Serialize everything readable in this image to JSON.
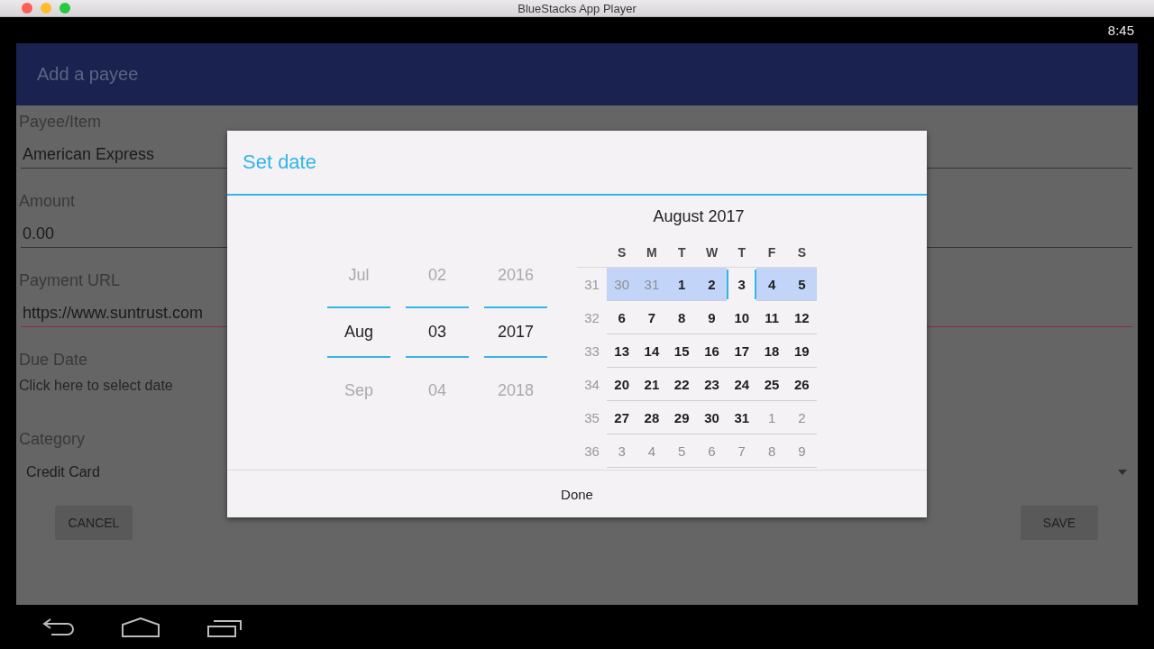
{
  "window": {
    "title": "BlueStacks App Player"
  },
  "status_bar": {
    "time": "8:45"
  },
  "app_bar": {
    "title": "Add a payee"
  },
  "form": {
    "fields": [
      {
        "kind": "text",
        "label": "Payee/Item",
        "value": "American Express",
        "error": false
      },
      {
        "kind": "text",
        "label": "Amount",
        "value": "0.00",
        "error": false
      },
      {
        "kind": "text",
        "label": "Payment URL",
        "value": "https://www.suntrust.com",
        "error": true
      },
      {
        "kind": "date",
        "label": "Due Date",
        "placeholder": "Click here to select date"
      },
      {
        "kind": "select",
        "label": "Category",
        "value": "Credit Card"
      }
    ],
    "buttons": [
      "CANCEL",
      "SAVE"
    ]
  },
  "dialog": {
    "title": "Set date",
    "spinners": [
      {
        "previous": "Jul",
        "current": "Aug",
        "next": "Sep"
      },
      {
        "previous": "02",
        "current": "03",
        "next": "04"
      },
      {
        "previous": "2016",
        "current": "2017",
        "next": "2018"
      }
    ],
    "calendar": {
      "title": "August 2017",
      "weekdays": [
        "S",
        "M",
        "T",
        "W",
        "T",
        "F",
        "S"
      ],
      "weeks": [
        {
          "number": "31",
          "highlighted": true,
          "days": [
            {
              "label": "30",
              "in_month": false,
              "selected": false
            },
            {
              "label": "31",
              "in_month": false,
              "selected": false
            },
            {
              "label": "1",
              "in_month": true,
              "selected": false
            },
            {
              "label": "2",
              "in_month": true,
              "selected": false
            },
            {
              "label": "3",
              "in_month": true,
              "selected": true
            },
            {
              "label": "4",
              "in_month": true,
              "selected": false
            },
            {
              "label": "5",
              "in_month": true,
              "selected": false
            }
          ]
        },
        {
          "number": "32",
          "highlighted": false,
          "days": [
            {
              "label": "6",
              "in_month": true,
              "selected": false
            },
            {
              "label": "7",
              "in_month": true,
              "selected": false
            },
            {
              "label": "8",
              "in_month": true,
              "selected": false
            },
            {
              "label": "9",
              "in_month": true,
              "selected": false
            },
            {
              "label": "10",
              "in_month": true,
              "selected": false
            },
            {
              "label": "11",
              "in_month": true,
              "selected": false
            },
            {
              "label": "12",
              "in_month": true,
              "selected": false
            }
          ]
        },
        {
          "number": "33",
          "highlighted": false,
          "days": [
            {
              "label": "13",
              "in_month": true,
              "selected": false
            },
            {
              "label": "14",
              "in_month": true,
              "selected": false
            },
            {
              "label": "15",
              "in_month": true,
              "selected": false
            },
            {
              "label": "16",
              "in_month": true,
              "selected": false
            },
            {
              "label": "17",
              "in_month": true,
              "selected": false
            },
            {
              "label": "18",
              "in_month": true,
              "selected": false
            },
            {
              "label": "19",
              "in_month": true,
              "selected": false
            }
          ]
        },
        {
          "number": "34",
          "highlighted": false,
          "days": [
            {
              "label": "20",
              "in_month": true,
              "selected": false
            },
            {
              "label": "21",
              "in_month": true,
              "selected": false
            },
            {
              "label": "22",
              "in_month": true,
              "selected": false
            },
            {
              "label": "23",
              "in_month": true,
              "selected": false
            },
            {
              "label": "24",
              "in_month": true,
              "selected": false
            },
            {
              "label": "25",
              "in_month": true,
              "selected": false
            },
            {
              "label": "26",
              "in_month": true,
              "selected": false
            }
          ]
        },
        {
          "number": "35",
          "highlighted": false,
          "days": [
            {
              "label": "27",
              "in_month": true,
              "selected": false
            },
            {
              "label": "28",
              "in_month": true,
              "selected": false
            },
            {
              "label": "29",
              "in_month": true,
              "selected": false
            },
            {
              "label": "30",
              "in_month": true,
              "selected": false
            },
            {
              "label": "31",
              "in_month": true,
              "selected": false
            },
            {
              "label": "1",
              "in_month": false,
              "selected": false
            },
            {
              "label": "2",
              "in_month": false,
              "selected": false
            }
          ]
        },
        {
          "number": "36",
          "highlighted": false,
          "days": [
            {
              "label": "3",
              "in_month": false,
              "selected": false
            },
            {
              "label": "4",
              "in_month": false,
              "selected": false
            },
            {
              "label": "5",
              "in_month": false,
              "selected": false
            },
            {
              "label": "6",
              "in_month": false,
              "selected": false
            },
            {
              "label": "7",
              "in_month": false,
              "selected": false
            },
            {
              "label": "8",
              "in_month": false,
              "selected": false
            },
            {
              "label": "9",
              "in_month": false,
              "selected": false
            }
          ]
        }
      ]
    },
    "button": "Done"
  }
}
